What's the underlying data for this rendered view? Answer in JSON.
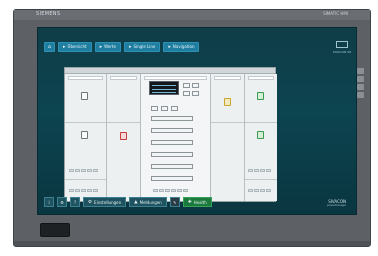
{
  "device": {
    "brand": "SIEMENS",
    "model": "SIMATIC HMI"
  },
  "top_nav": {
    "home_icon": "home-icon",
    "buttons": [
      {
        "label": "Übersicht",
        "icon": "overview-icon"
      },
      {
        "label": "Werte",
        "icon": "values-icon"
      },
      {
        "label": "Single Line",
        "icon": "single-line-icon"
      },
      {
        "label": "Navigation",
        "icon": "navigation-icon"
      }
    ],
    "caption": "SIVACON S8"
  },
  "bottom_bar": {
    "small_buttons": [
      "i",
      "⚙",
      "?"
    ],
    "buttons": [
      {
        "label": "Einstellungen",
        "icon": "settings-icon"
      },
      {
        "label": "Meldungen",
        "icon": "alarm-icon"
      }
    ],
    "status_button": {
      "label": "Health",
      "icon": "health-icon"
    },
    "brand_title": "SIVACON",
    "brand_sub": "powermanager"
  },
  "colors": {
    "screen_bg": "#0c4450",
    "nav_button": "#1f7ea0",
    "status_green": "#1c7a3c",
    "bezel": "#5d6166"
  }
}
